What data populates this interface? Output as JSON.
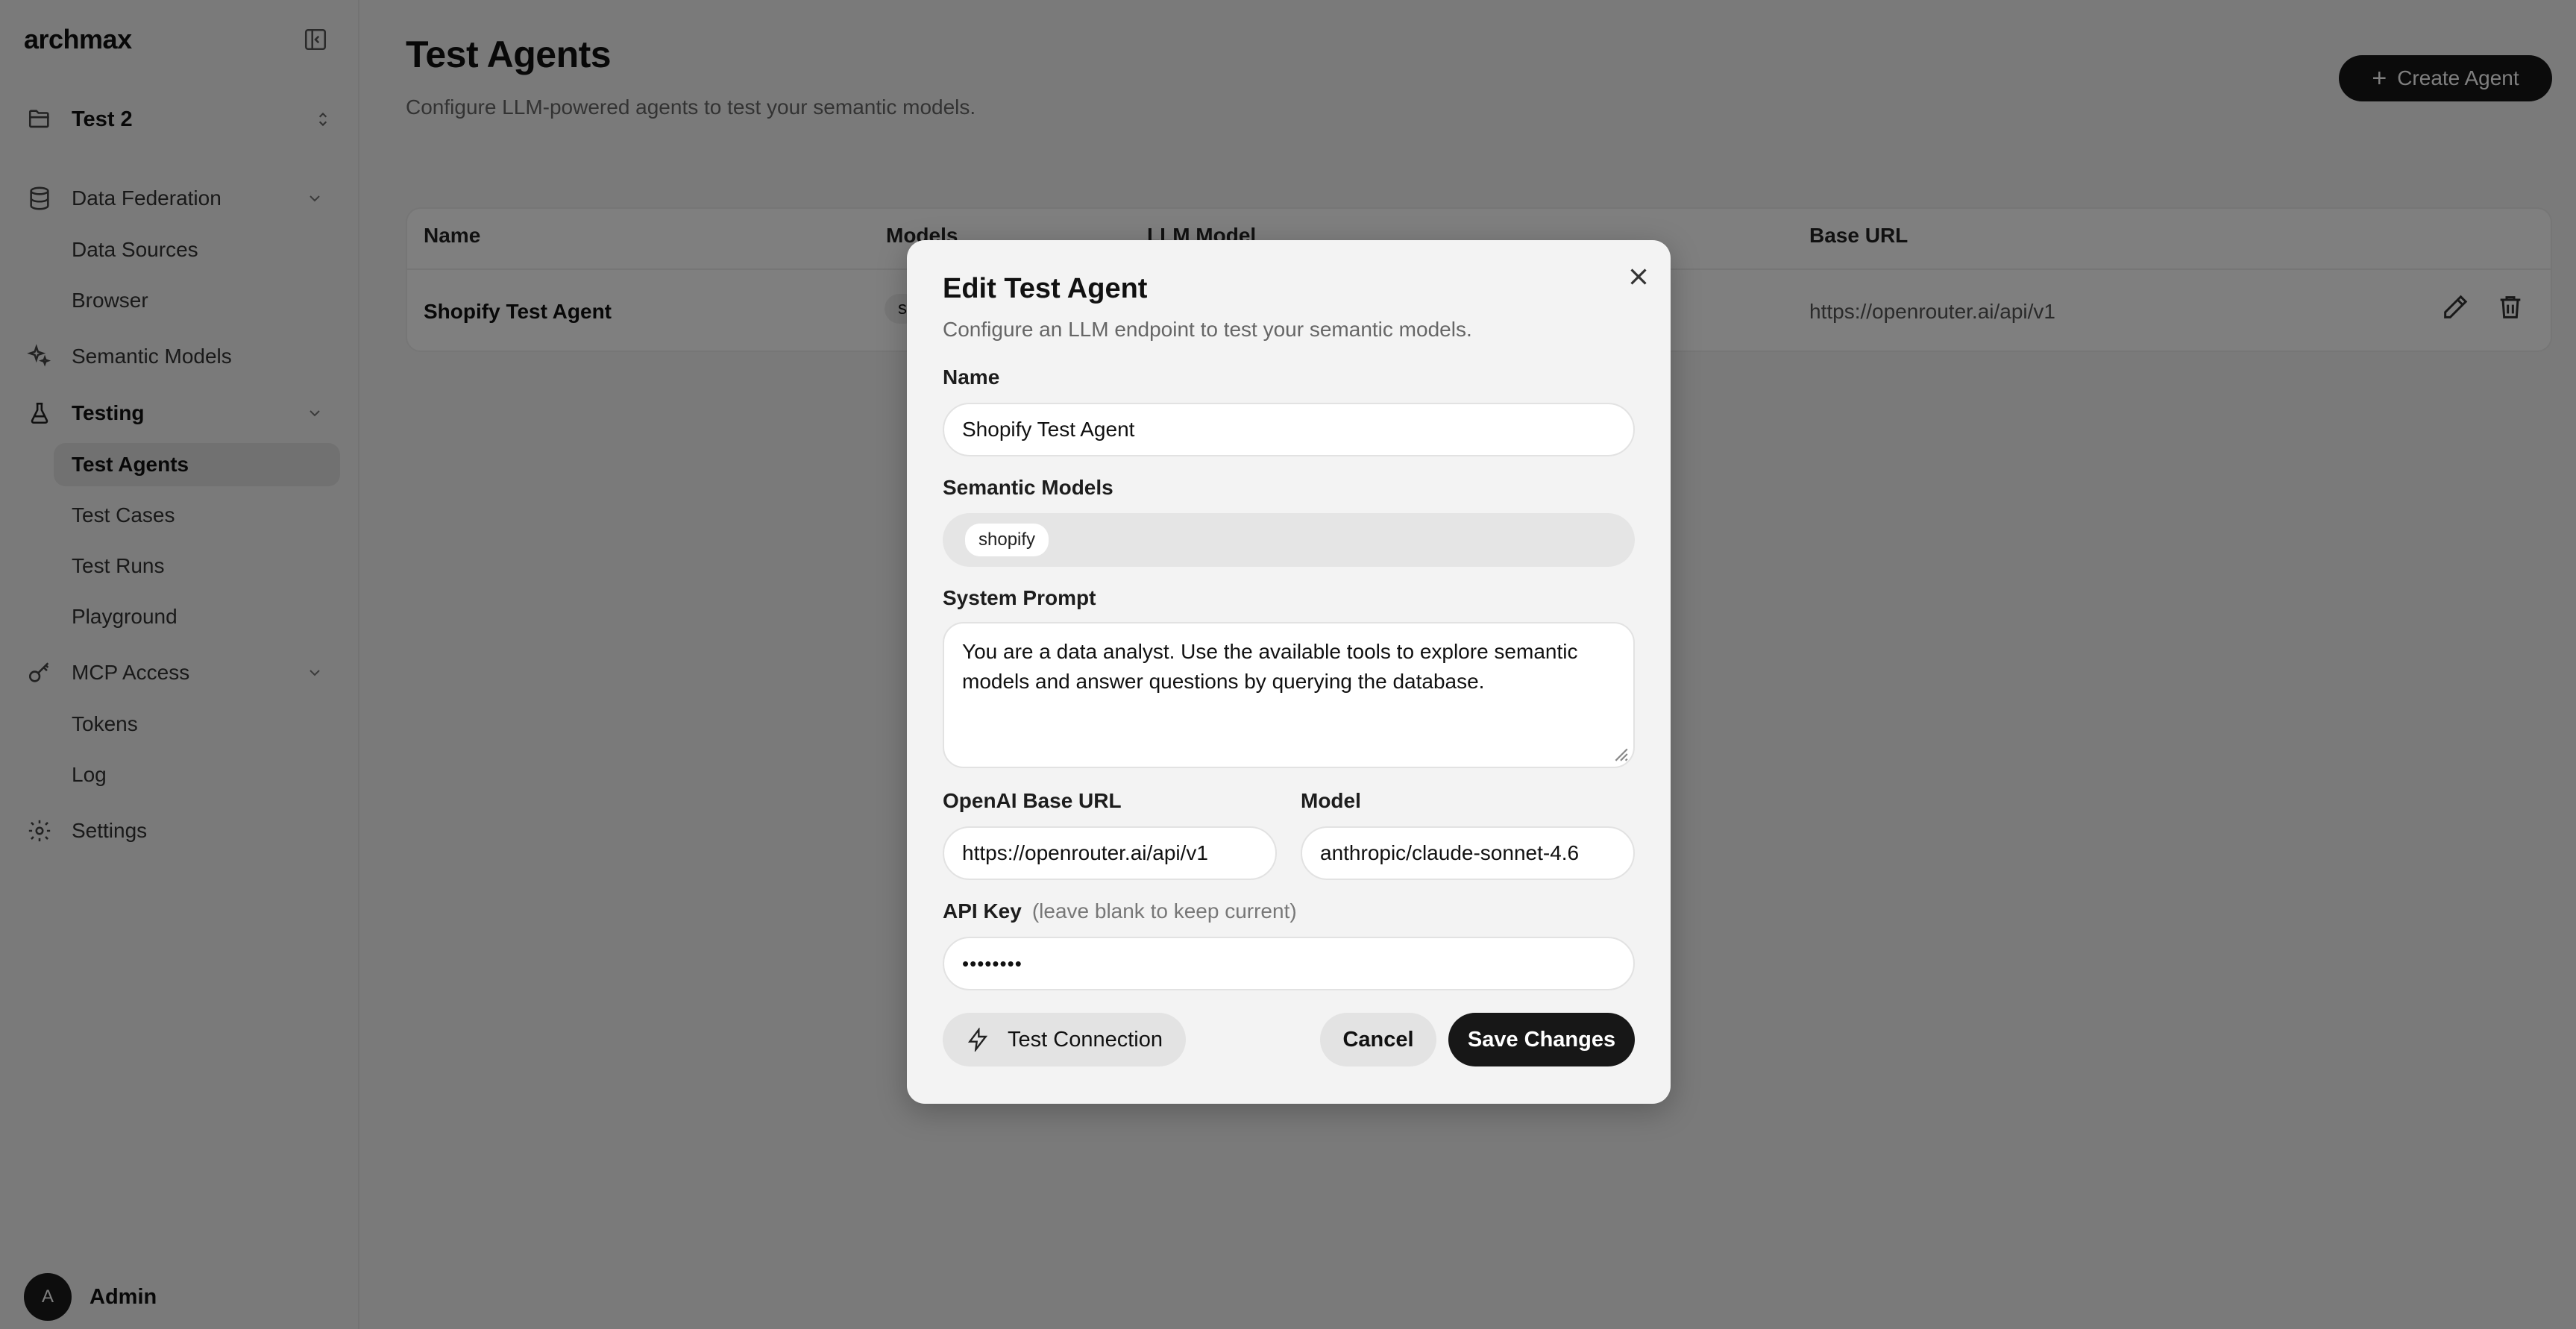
{
  "app": {
    "brand": "archmax"
  },
  "sidebar": {
    "workspace": "Test 2",
    "sections": {
      "data_federation": "Data Federation",
      "data_sources": "Data Sources",
      "browser": "Browser",
      "semantic_models": "Semantic Models",
      "testing": "Testing",
      "test_agents": "Test Agents",
      "test_cases": "Test Cases",
      "test_runs": "Test Runs",
      "playground": "Playground",
      "mcp_access": "MCP Access",
      "tokens": "Tokens",
      "log": "Log",
      "settings": "Settings"
    },
    "user": {
      "initial": "A",
      "name": "Admin"
    }
  },
  "page": {
    "title": "Test Agents",
    "subtitle": "Configure LLM-powered agents to test your semantic models.",
    "create_button": "Create Agent"
  },
  "table": {
    "headers": {
      "name": "Name",
      "models": "Models",
      "llm_model": "LLM Model",
      "base_url": "Base URL"
    },
    "rows": [
      {
        "name": "Shopify Test Agent",
        "models": "s",
        "base_url": "https://openrouter.ai/api/v1"
      }
    ]
  },
  "modal": {
    "title": "Edit Test Agent",
    "description": "Configure an LLM endpoint to test your semantic models.",
    "name_label": "Name",
    "name_value": "Shopify Test Agent",
    "semantic_models_label": "Semantic Models",
    "semantic_models": [
      "shopify"
    ],
    "system_prompt_label": "System Prompt",
    "system_prompt_value": "You are a data analyst. Use the available tools to explore semantic models and answer questions by querying the database.",
    "base_url_label": "OpenAI Base URL",
    "base_url_value": "https://openrouter.ai/api/v1",
    "model_label": "Model",
    "model_value": "anthropic/claude-sonnet-4.6",
    "api_key_label": "API Key",
    "api_key_hint": "(leave blank to keep current)",
    "api_key_value": "••••••••",
    "test_button": "Test Connection",
    "cancel_button": "Cancel",
    "save_button": "Save Changes"
  }
}
